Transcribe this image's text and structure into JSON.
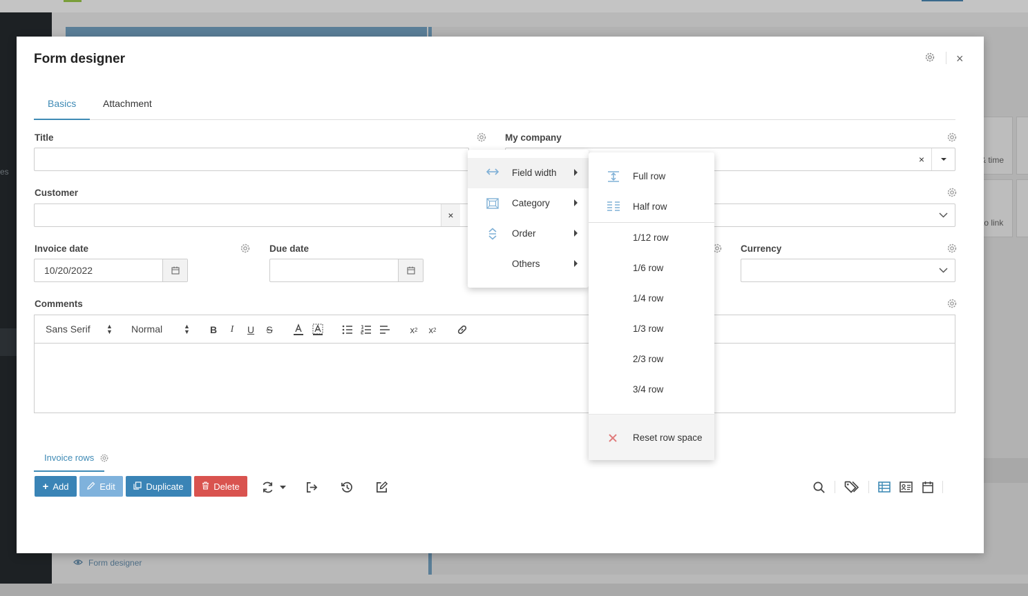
{
  "background": {
    "sidebar_text": "es",
    "tiles": [
      "& time",
      "to link"
    ],
    "footer_link": "Form designer"
  },
  "modal": {
    "title": "Form designer",
    "close_label": "×",
    "tabs": [
      {
        "label": "Basics",
        "active": true
      },
      {
        "label": "Attachment",
        "active": false
      }
    ],
    "fields": {
      "title": {
        "label": "Title",
        "value": ""
      },
      "my_company": {
        "label": "My company",
        "value": "",
        "clear": "×"
      },
      "customer": {
        "label": "Customer",
        "value": "",
        "clear": "×"
      },
      "invoice_date": {
        "label": "Invoice date",
        "value": "10/20/2022"
      },
      "due_date": {
        "label": "Due date",
        "value": ""
      },
      "currency": {
        "label": "Currency",
        "value": ""
      },
      "comments": {
        "label": "Comments"
      }
    },
    "editor": {
      "font": "Sans Serif",
      "size": "Normal",
      "buttons": [
        "bold",
        "italic",
        "underline",
        "strike",
        "text-color",
        "background-color",
        "bullet-list",
        "ordered-list",
        "align",
        "subscript",
        "superscript",
        "link"
      ]
    },
    "rows_tab": {
      "label": "Invoice rows"
    },
    "actions": {
      "add": "Add",
      "edit": "Edit",
      "duplicate": "Duplicate",
      "delete": "Delete"
    },
    "colors": {
      "primary": "#3e8ab5",
      "add": "#3a84b6",
      "edit": "#7fb2dc",
      "duplicate": "#3a84b6",
      "delete": "#d9534f",
      "menu_icon": "#7fb0d6",
      "reset_icon": "#e07b7b"
    }
  },
  "context_menu": {
    "items": [
      {
        "label": "Field width",
        "icon": "arrows-horizontal-icon",
        "active": true
      },
      {
        "label": "Category",
        "icon": "category-frame-icon",
        "active": false
      },
      {
        "label": "Order",
        "icon": "order-arrows-icon",
        "active": false
      },
      {
        "label": "Others",
        "icon": "",
        "active": false
      }
    ]
  },
  "submenu": {
    "items": [
      {
        "label": "Full row",
        "icon": "full-row-icon"
      },
      {
        "label": "Half row",
        "icon": "half-row-icon"
      },
      {
        "label": "1/12 row"
      },
      {
        "label": "1/6 row"
      },
      {
        "label": "1/4 row"
      },
      {
        "label": "1/3 row"
      },
      {
        "label": "2/3 row"
      },
      {
        "label": "3/4 row"
      }
    ],
    "reset": {
      "label": "Reset row space",
      "icon": "close-icon"
    }
  }
}
